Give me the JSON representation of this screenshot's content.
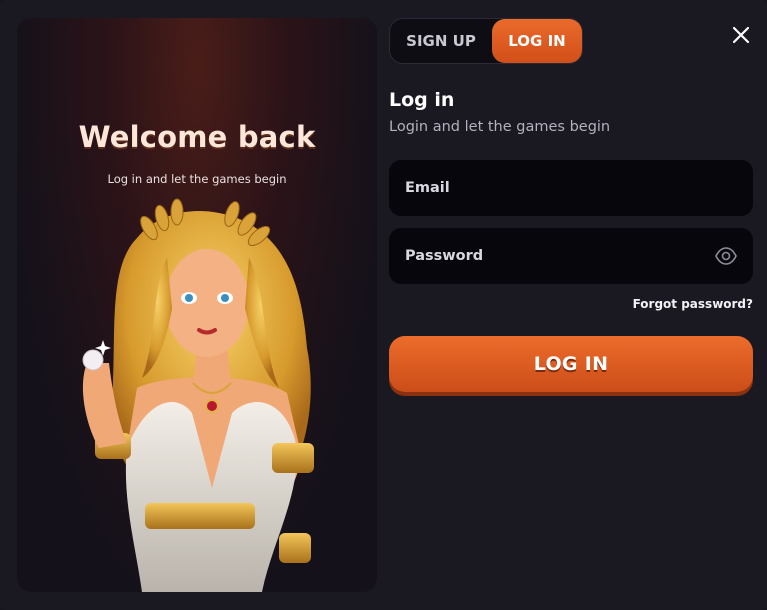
{
  "promo": {
    "title": "Welcome back",
    "subtitle": "Log in and let the games begin"
  },
  "tabs": {
    "signup_label": "SIGN UP",
    "login_label": "LOG IN",
    "active": "login"
  },
  "form": {
    "title": "Log in",
    "subtitle": "Login and let the games begin",
    "email_placeholder": "Email",
    "password_placeholder": "Password",
    "forgot_label": "Forgot password?",
    "submit_label": "LOG IN"
  },
  "icons": {
    "close": "close-icon",
    "password_toggle": "eye-icon"
  },
  "colors": {
    "accent": "#e0612a",
    "background": "#1a1922",
    "field_background": "#07060c"
  }
}
